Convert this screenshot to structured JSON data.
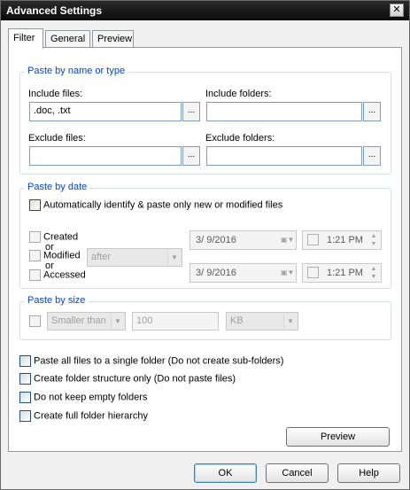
{
  "window": {
    "title": "Advanced Settings",
    "close_glyph": "✕"
  },
  "tabs": [
    {
      "label": "Filter",
      "active": true
    },
    {
      "label": "General",
      "active": false
    },
    {
      "label": "Preview",
      "active": false
    }
  ],
  "paste_by_name": {
    "title": "Paste by name or type",
    "include_files_label": "Include files:",
    "include_files_value": ".doc, .txt",
    "include_folders_label": "Include folders:",
    "include_folders_value": "",
    "exclude_files_label": "Exclude files:",
    "exclude_files_value": "",
    "exclude_folders_label": "Exclude folders:",
    "exclude_folders_value": "",
    "browse_glyph": "..."
  },
  "paste_by_date": {
    "title": "Paste by date",
    "auto_identify_label": "Automatically identify & paste only new or modified files",
    "created_label": "Created",
    "or1": "or",
    "modified_label": "Modified",
    "or2": "or",
    "accessed_label": "Accessed",
    "condition_value": "after",
    "date1": "3/  9/2016",
    "time1": "1:21 PM",
    "date2": "3/  9/2016",
    "time2": "1:21 PM"
  },
  "paste_by_size": {
    "title": "Paste by size",
    "comparison_value": "Smaller than",
    "size_value": "100",
    "unit_value": "KB"
  },
  "options": [
    {
      "label": "Paste all files to a single folder (Do not create sub-folders)"
    },
    {
      "label": "Create folder structure only (Do not paste files)"
    },
    {
      "label": "Do not keep empty folders"
    },
    {
      "label": "Create full folder hierarchy"
    }
  ],
  "preview_button": "Preview",
  "footer": {
    "ok": "OK",
    "cancel": "Cancel",
    "help": "Help"
  }
}
